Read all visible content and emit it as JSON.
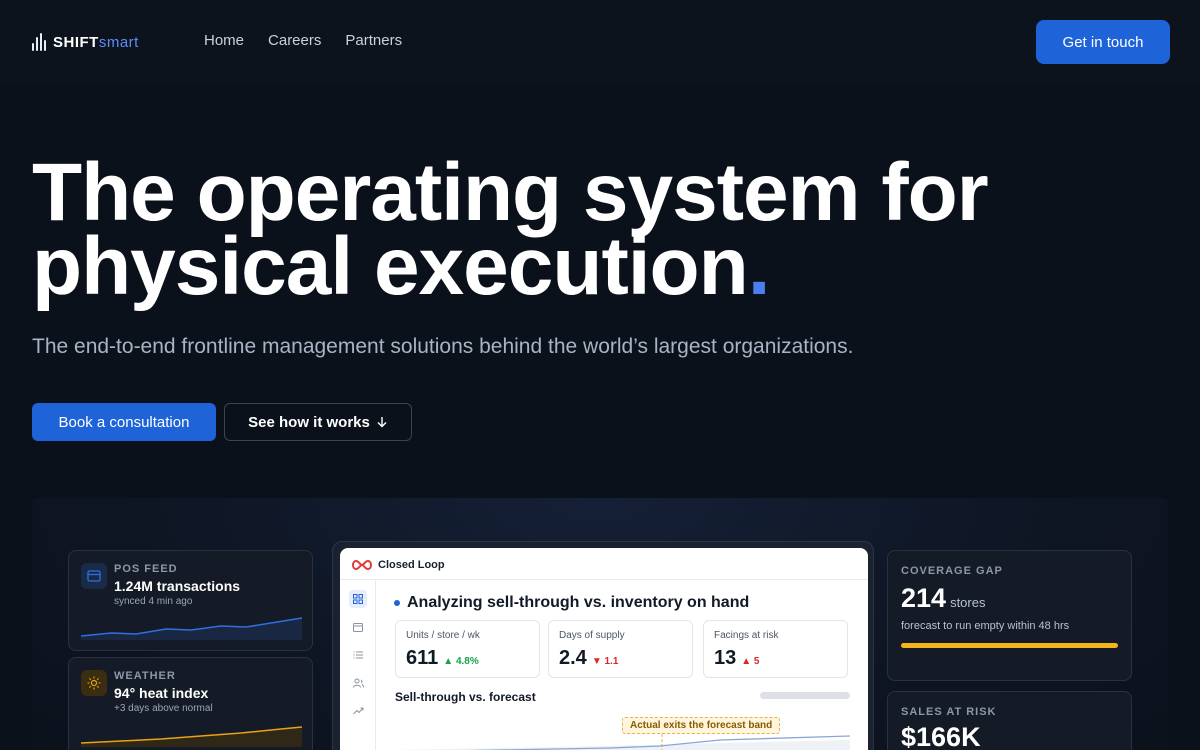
{
  "nav": {
    "logo_shift": "SHIFT",
    "logo_smart": "smart",
    "links": [
      {
        "label": "Home"
      },
      {
        "label": "Careers"
      },
      {
        "label": "Partners"
      }
    ],
    "cta": "Get in touch"
  },
  "hero": {
    "title_line1": "The operating system for",
    "title_line2": "physical execution",
    "title_dot": ".",
    "subtitle": "The end-to-end frontline management solutions behind the world’s largest organizations.",
    "primary_button": "Book a consultation",
    "secondary_button": "See how it works",
    "secondary_icon": "arrow-down-icon"
  },
  "dashboard": {
    "pos_feed": {
      "label": "POS FEED",
      "value": "1.24M transactions",
      "note": "synced 4 min ago",
      "icon": "card-icon",
      "color": "#2f6fe0"
    },
    "weather": {
      "label": "WEATHER",
      "value": "94° heat index",
      "note": "+3 days above normal",
      "icon": "sun-icon",
      "color": "#e8a316"
    },
    "closed_loop": {
      "title": "Closed Loop",
      "heading": "Analyzing sell-through vs. inventory on hand",
      "metrics": [
        {
          "label": "Units / store / wk",
          "value": "611",
          "delta": "▲ 4.8%",
          "dir": "up"
        },
        {
          "label": "Days of supply",
          "value": "2.4",
          "delta": "▼ 1.1",
          "dir": "down"
        },
        {
          "label": "Facings at risk",
          "value": "13",
          "delta": "▲ 5",
          "dir": "down"
        }
      ],
      "chart_title": "Sell-through vs. forecast",
      "annotation": "Actual exits the forecast band"
    },
    "coverage_gap": {
      "label": "COVERAGE GAP",
      "value": "214",
      "unit": "stores",
      "note": "forecast to run empty within 48 hrs",
      "bar_color": "#f3b41d"
    },
    "sales_at_risk": {
      "label": "SALES AT RISK",
      "value": "$166K"
    }
  },
  "colors": {
    "background": "#0b111b",
    "accent": "#1e63d8",
    "accent_dot": "#4a7ff0"
  }
}
